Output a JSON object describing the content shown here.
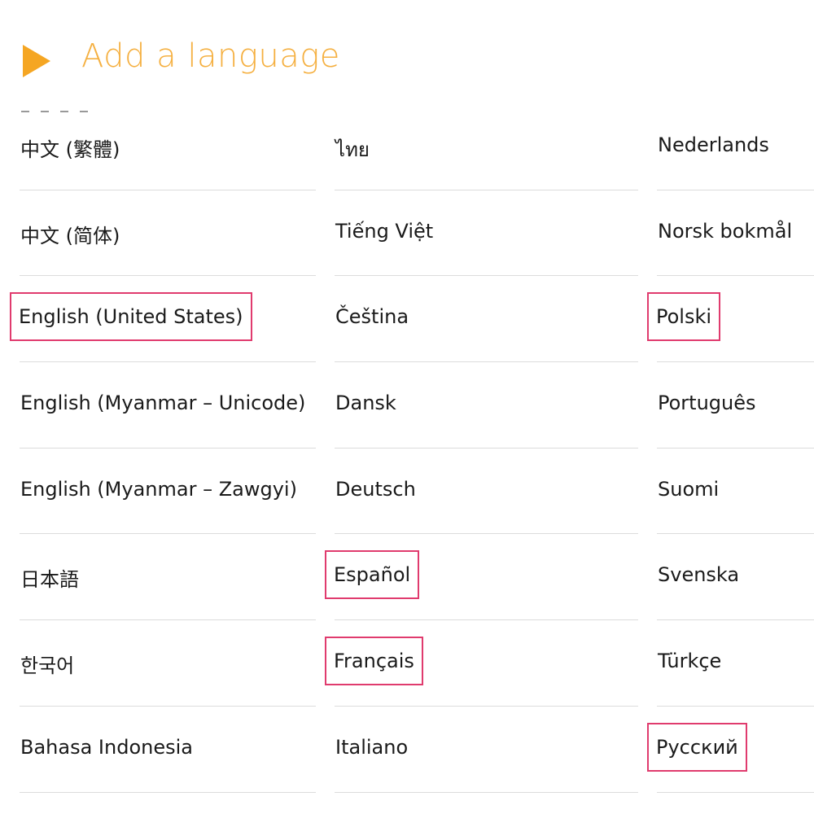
{
  "header": {
    "title": "Add a language",
    "icon": "play-triangle-icon",
    "accent_color": "#f5a623"
  },
  "highlight_color": "#e03b6e",
  "languages": {
    "column_1": [
      {
        "label": "中文 (繁體)",
        "highlighted": false
      },
      {
        "label": "中文 (简体)",
        "highlighted": false
      },
      {
        "label": "English (United States)",
        "highlighted": true
      },
      {
        "label": "English (Myanmar – Unicode)",
        "highlighted": false
      },
      {
        "label": "English (Myanmar – Zawgyi)",
        "highlighted": false
      },
      {
        "label": "日本語",
        "highlighted": false
      },
      {
        "label": "한국어",
        "highlighted": false
      },
      {
        "label": "Bahasa Indonesia",
        "highlighted": false
      }
    ],
    "column_2": [
      {
        "label": "ไทย",
        "highlighted": false
      },
      {
        "label": "Tiếng Việt",
        "highlighted": false
      },
      {
        "label": "Čeština",
        "highlighted": false
      },
      {
        "label": "Dansk",
        "highlighted": false
      },
      {
        "label": "Deutsch",
        "highlighted": false
      },
      {
        "label": "Español",
        "highlighted": true
      },
      {
        "label": "Français",
        "highlighted": true
      },
      {
        "label": "Italiano",
        "highlighted": false
      }
    ],
    "column_3": [
      {
        "label": "Nederlands",
        "highlighted": false
      },
      {
        "label": "Norsk bokmål",
        "highlighted": false
      },
      {
        "label": "Polski",
        "highlighted": true
      },
      {
        "label": "Português",
        "highlighted": false
      },
      {
        "label": "Suomi",
        "highlighted": false
      },
      {
        "label": "Svenska",
        "highlighted": false
      },
      {
        "label": "Türkçe",
        "highlighted": false
      },
      {
        "label": "Русский",
        "highlighted": true
      }
    ]
  }
}
